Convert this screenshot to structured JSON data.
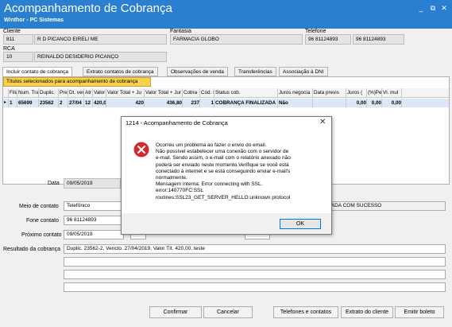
{
  "window": {
    "title": "Acompanhamento de Cobrança",
    "subtitle": "Winthor - PC Sistemas",
    "controls": {
      "minimize": "_",
      "restore": "⧉",
      "close": "✕"
    }
  },
  "header": {
    "cliente_label": "Cliente",
    "cliente_code": "811",
    "cliente_name": "R D PICANCO EIRELI  ME",
    "fantasia_label": "Fantasia",
    "fantasia_value": "FARMACIA GLOBO",
    "telefone_label": "Telefone",
    "telefone1": "96 81124893",
    "telefone2": "96 81124893",
    "rca_label": "RCA",
    "rca_code": "10",
    "rca_name": "REINALDO DESIDERIO PICANÇO"
  },
  "tabs": [
    {
      "label": "Incluir contato de cobrança"
    },
    {
      "label": "Extrato contatos de cobrança"
    },
    {
      "label": "Observações de venda"
    },
    {
      "label": "Transferências"
    },
    {
      "label": "Associação à DNI"
    }
  ],
  "grid": {
    "tab_label": "Títulos selecionados para acompanhamento de cobrança",
    "columns": [
      "Filia",
      "Num. Tran",
      "Duplic.",
      "Pre",
      "Dt. ver",
      "Atr",
      "Valor tí",
      "Valor Total + Ju",
      "Valor Total + Jur",
      "Cobra",
      "Cód. s",
      "Status cob.",
      "Juros negocia",
      "Data previs",
      "Juros (",
      "(%)Pe",
      "Vl. mul"
    ],
    "row": {
      "marker": "▸",
      "values": [
        "1",
        "65699",
        "23562",
        "2",
        "27/04",
        "12",
        "420,00",
        "420",
        "436,80",
        "237",
        "1",
        "COBRANÇA FINALIZADA",
        "Não",
        "",
        "0,00",
        "0,00",
        "0,00"
      ]
    }
  },
  "form": {
    "data_label": "Data",
    "data_value": "09/05/2019",
    "meio_label": "Meio de contato",
    "meio_value": "Telefônico",
    "fone_label": "Fone contato",
    "fone_value": "96 81124893",
    "proximo_label": "Próximo contato",
    "proximo_value": "09/05/2019",
    "status_value": "IZADA COM SUCESSO",
    "resultado_label": "Resultado da cobrança",
    "resultado_value": "Duplic. 23562-2, Vencto. 27/04/2019, Valor Tít. 420,00.   teste"
  },
  "buttons": {
    "confirmar": "Confirmar",
    "cancelar": "Cancelar",
    "telefones": "Telefones e contatos",
    "extrato": "Extrato do cliente",
    "emitir": "Emitir boleto"
  },
  "dialog": {
    "title": "1214 - Acompanhamento de Cobrança",
    "close": "✕",
    "message_lines": [
      "Ocorreu um problema ao fazer o envio do email.",
      "Não possível estabelecer uma conexão com o servidor de",
      "e-mail. Sendo assim, o e-mail com o relatório anexado não",
      "poderá ser enviado neste momento.Verifique se você está",
      "conectado à internet e se está conseguindo enviar e-mail's",
      "normalmente.",
      "Mensagem interna: Error connecting with SSL.",
      "error:140770FC:SSL",
      "routines:SSL23_GET_SERVER_HELLO:unknown protocol"
    ],
    "ok": "OK"
  },
  "colors": {
    "titlebar": "#2b7fd0",
    "grid_tab": "#f7d24a",
    "error_icon": "#d9262c",
    "ok_border": "#0078d7"
  }
}
